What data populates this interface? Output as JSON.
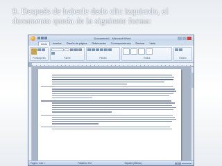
{
  "slide": {
    "title_line1": "9. Después de haberle dado clic izquierdo, el",
    "title_line2": "documento queda de la siguiente forma:"
  },
  "word": {
    "window_title": "Documento1 - Microsoft Word",
    "tabs": [
      "Inicio",
      "Insertar",
      "Diseño de página",
      "Referencias",
      "Correspondencia",
      "Revisar",
      "Vista"
    ],
    "ribbon_groups": [
      "Portapapeles",
      "Fuente",
      "Párrafo",
      "Estilos",
      "Edición"
    ],
    "status": {
      "page": "Página: 1 de 1",
      "words": "Palabras: 372",
      "language": "Español (México)"
    }
  },
  "colors": {
    "title_text": "#ffffff",
    "window_frame": "#a9b6c7",
    "ribbon_bg": "#dbe6f4"
  }
}
